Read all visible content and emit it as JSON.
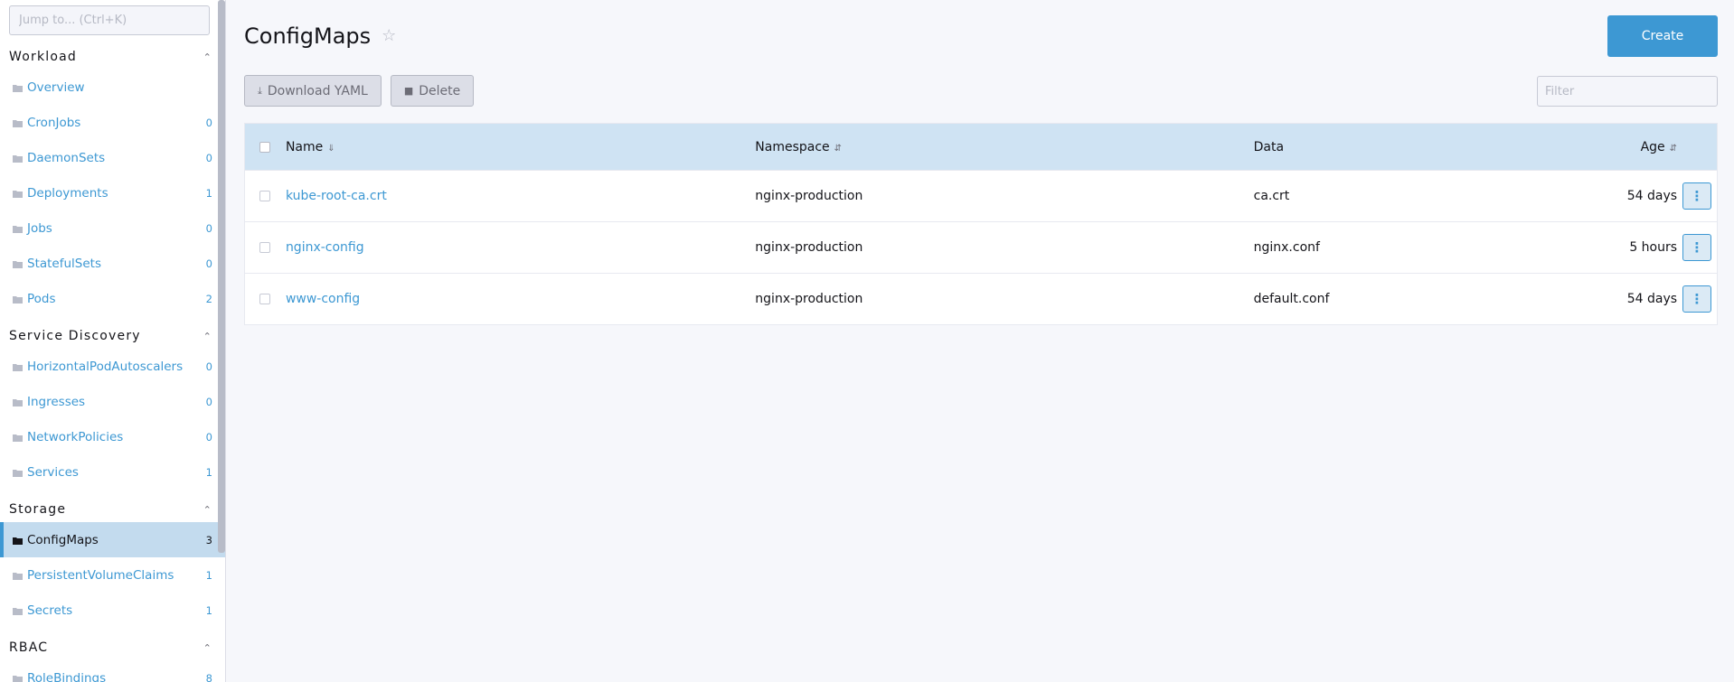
{
  "sidebar": {
    "jump_placeholder": "Jump to... (Ctrl+K)",
    "groups": [
      {
        "title": "Workload",
        "items": [
          {
            "label": "Overview",
            "count": ""
          },
          {
            "label": "CronJobs",
            "count": "0"
          },
          {
            "label": "DaemonSets",
            "count": "0"
          },
          {
            "label": "Deployments",
            "count": "1"
          },
          {
            "label": "Jobs",
            "count": "0"
          },
          {
            "label": "StatefulSets",
            "count": "0"
          },
          {
            "label": "Pods",
            "count": "2"
          }
        ]
      },
      {
        "title": "Service Discovery",
        "items": [
          {
            "label": "HorizontalPodAutoscalers",
            "count": "0"
          },
          {
            "label": "Ingresses",
            "count": "0"
          },
          {
            "label": "NetworkPolicies",
            "count": "0"
          },
          {
            "label": "Services",
            "count": "1"
          }
        ]
      },
      {
        "title": "Storage",
        "items": [
          {
            "label": "ConfigMaps",
            "count": "3",
            "active": true
          },
          {
            "label": "PersistentVolumeClaims",
            "count": "1"
          },
          {
            "label": "Secrets",
            "count": "1"
          }
        ]
      },
      {
        "title": "RBAC",
        "items": [
          {
            "label": "RoleBindings",
            "count": "8"
          }
        ]
      }
    ]
  },
  "header": {
    "title": "ConfigMaps",
    "create_label": "Create"
  },
  "toolbar": {
    "download_label": "Download YAML",
    "delete_label": "Delete",
    "filter_placeholder": "Filter"
  },
  "table": {
    "columns": {
      "name": "Name",
      "namespace": "Namespace",
      "data": "Data",
      "age": "Age"
    },
    "rows": [
      {
        "name": "kube-root-ca.crt",
        "namespace": "nginx-production",
        "data": "ca.crt",
        "age": "54 days"
      },
      {
        "name": "nginx-config",
        "namespace": "nginx-production",
        "data": "nginx.conf",
        "age": "5 hours"
      },
      {
        "name": "www-config",
        "namespace": "nginx-production",
        "data": "default.conf",
        "age": "54 days"
      }
    ]
  },
  "colors": {
    "accent": "#3d98d3",
    "active_bg": "#c3dbee",
    "header_bg": "#cfe3f3"
  }
}
